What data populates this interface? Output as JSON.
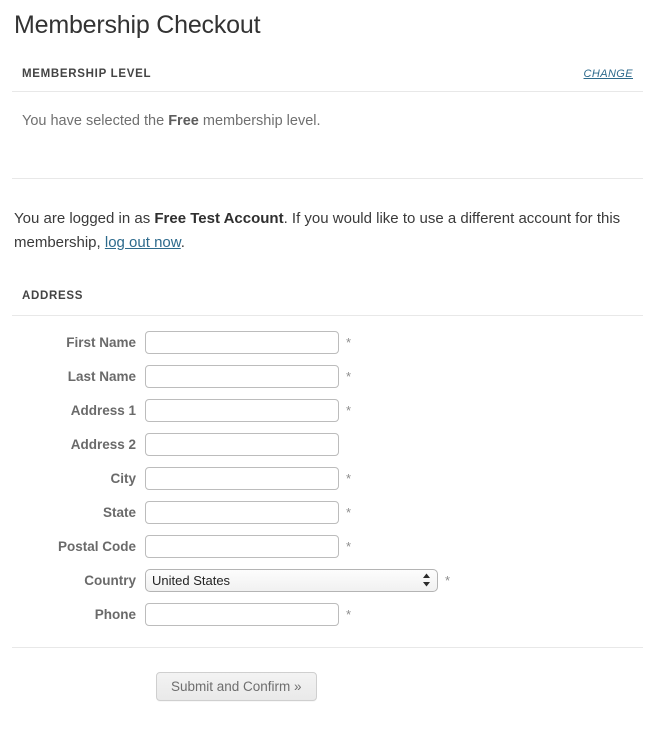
{
  "page": {
    "title": "Membership Checkout"
  },
  "membership_level": {
    "heading": "MEMBERSHIP LEVEL",
    "change_label": "CHANGE",
    "description_prefix": "You have selected the ",
    "level_name": "Free",
    "description_suffix": " membership level."
  },
  "account_notice": {
    "prefix": "You are logged in as ",
    "account_name": "Free Test Account",
    "middle": ". If you would like to use a different account for this membership, ",
    "logout_label": "log out now",
    "suffix": "."
  },
  "address": {
    "heading": "ADDRESS",
    "required_marker": "*",
    "fields": [
      {
        "label": "First Name",
        "value": "",
        "placeholder": "",
        "required": true,
        "type": "text"
      },
      {
        "label": "Last Name",
        "value": "",
        "placeholder": "",
        "required": true,
        "type": "text"
      },
      {
        "label": "Address 1",
        "value": "",
        "placeholder": "",
        "required": true,
        "type": "text"
      },
      {
        "label": "Address 2",
        "value": "",
        "placeholder": "",
        "required": false,
        "type": "text"
      },
      {
        "label": "City",
        "value": "",
        "placeholder": "",
        "required": true,
        "type": "text"
      },
      {
        "label": "State",
        "value": "",
        "placeholder": "",
        "required": true,
        "type": "text"
      },
      {
        "label": "Postal Code",
        "value": "",
        "placeholder": "",
        "required": true,
        "type": "text"
      },
      {
        "label": "Country",
        "value": "United States",
        "placeholder": "",
        "required": true,
        "type": "select"
      },
      {
        "label": "Phone",
        "value": "",
        "placeholder": "",
        "required": true,
        "type": "text"
      }
    ],
    "country_selected": "United States"
  },
  "submit": {
    "label": "Submit and Confirm »"
  },
  "colors": {
    "link": "#2d6a8c",
    "label": "#6a6a6a",
    "title": "#333333",
    "body": "#6f6f6f",
    "divider": "#e8e8e8",
    "input_border": "#bcbcbc"
  }
}
